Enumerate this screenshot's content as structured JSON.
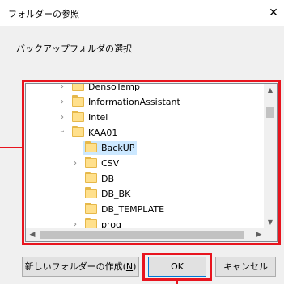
{
  "window": {
    "title": "フォルダーの参照",
    "close_glyph": "✕"
  },
  "prompt": "バックアップフォルダの選択",
  "tree": {
    "items": [
      {
        "label": "DensoTemp",
        "chevron": "›",
        "selected": false
      },
      {
        "label": "InformationAssistant",
        "chevron": "›",
        "selected": false
      },
      {
        "label": "Intel",
        "chevron": "›",
        "selected": false
      },
      {
        "label": "KAA01",
        "chevron": "⌄",
        "selected": false
      },
      {
        "label": "BackUP",
        "chevron": "",
        "selected": true
      },
      {
        "label": "CSV",
        "chevron": "›",
        "selected": false
      },
      {
        "label": "DB",
        "chevron": "",
        "selected": false
      },
      {
        "label": "DB_BK",
        "chevron": "",
        "selected": false
      },
      {
        "label": "DB_TEMPLATE",
        "chevron": "",
        "selected": false
      },
      {
        "label": "prog",
        "chevron": "›",
        "selected": false
      }
    ]
  },
  "buttons": {
    "new_folder_text": "新しいフォルダーの作成(",
    "new_folder_mnemonic": "N",
    "new_folder_suffix": ")",
    "ok": "OK",
    "cancel": "キャンセル"
  },
  "colors": {
    "highlight": "#e8141e",
    "selection": "#cce8ff",
    "folder": "#ffe08c"
  }
}
